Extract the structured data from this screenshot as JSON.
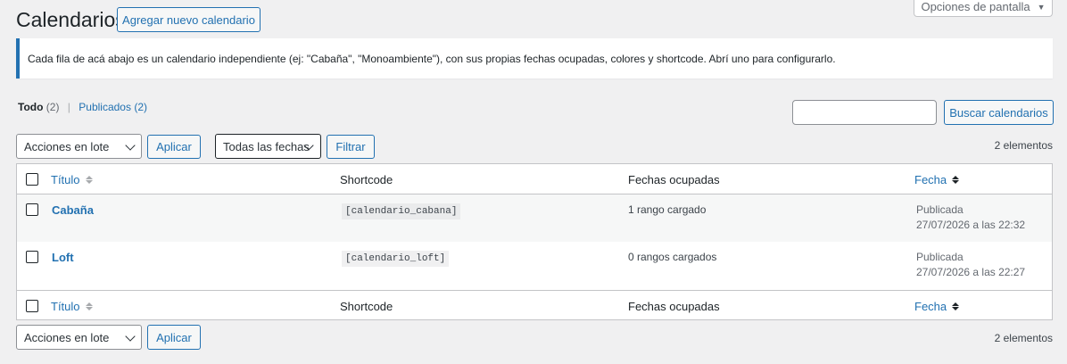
{
  "page": {
    "title": "Calendarios",
    "add_new_label": "Agregar nuevo calendario",
    "screen_options_label": "Opciones de pantalla",
    "notice": "Cada fila de acá abajo es un calendario independiente (ej: \"Cabaña\", \"Monoambiente\"), con sus propias fechas ocupadas, colores y shortcode. Abrí uno para configurarlo."
  },
  "views": {
    "all_label": "Todo",
    "all_count": "(2)",
    "separator": "|",
    "published_label": "Publicados",
    "published_count": "(2)"
  },
  "search": {
    "value": "",
    "button_label": "Buscar calendarios"
  },
  "tablenav_top": {
    "bulk_selected": "Acciones en lote",
    "apply_label": "Aplicar",
    "dates_selected": "Todas las fechas",
    "filter_label": "Filtrar",
    "count": "2 elementos"
  },
  "tablenav_bottom": {
    "bulk_selected": "Acciones en lote",
    "apply_label": "Aplicar",
    "count": "2 elementos"
  },
  "table": {
    "columns": {
      "title": "Título",
      "shortcode": "Shortcode",
      "dates": "Fechas ocupadas",
      "date": "Fecha"
    },
    "rows": [
      {
        "title": "Cabaña",
        "shortcode": "[calendario_cabana]",
        "dates": "1 rango cargado",
        "status": "Publicada",
        "date": "27/07/2026 a las 22:32"
      },
      {
        "title": "Loft",
        "shortcode": "[calendario_loft]",
        "dates": "0 rangos cargados",
        "status": "Publicada",
        "date": "27/07/2026 a las 22:27"
      }
    ]
  },
  "colors": {
    "accent": "#2271b1",
    "background": "#f0f0f1",
    "text": "#1d2327"
  },
  "icons": {
    "sort": "sort-arrows-icon",
    "dropdown": "chevron-down-icon",
    "screen_options": "caret-down-icon"
  }
}
